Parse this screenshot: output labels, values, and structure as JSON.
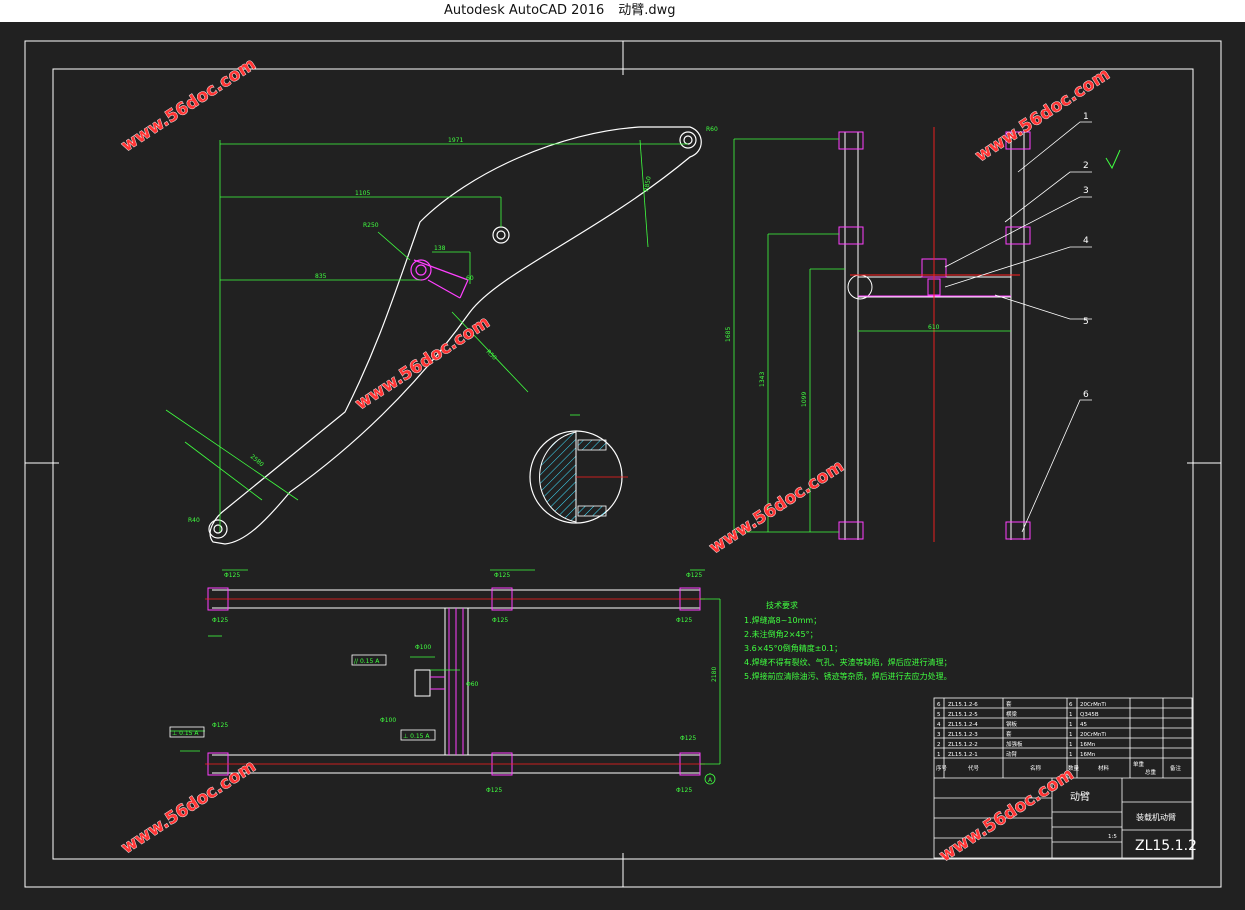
{
  "window": {
    "app_title": "Autodesk AutoCAD 2016",
    "file_name": "动臂.dwg"
  },
  "colors": {
    "background": "#212121",
    "outline": "#ffffff",
    "dimension": "#40ff40",
    "part": "#ff40ff",
    "centerline": "#ff2020",
    "watermark": "#ff3535"
  },
  "watermark": {
    "text": "www.56doc.com"
  },
  "drawing": {
    "drawing_number": "ZL15.1.2",
    "scale": "1:5",
    "balloons": [
      "1",
      "2",
      "3",
      "4",
      "5",
      "6"
    ],
    "dimensions": {
      "side": [
        "1971",
        "1105",
        "835",
        "R250",
        "138",
        "60",
        "R850",
        "R60",
        "R40",
        "R50",
        "2580"
      ],
      "front": [
        "1685",
        "1343",
        "1099",
        "610"
      ],
      "plan": [
        "Φ125",
        "Φ125",
        "Φ125",
        "Φ125",
        "Φ125",
        "Φ125",
        "Φ125",
        "Φ125",
        "Φ100",
        "Φ100",
        "Φ60",
        "2180",
        "Φ125",
        "Φ125"
      ]
    },
    "tolerance_frames": [
      "// 0.15 A",
      "⊥ 0.15 A",
      "⊥ 0.15 A"
    ],
    "datum_label": "A"
  },
  "tech_notes": {
    "title": "技术要求",
    "lines": [
      "1.焊缝高8~10mm；",
      "2.未注倒角2×45°；",
      "3.6×45°0倒角精度±0.1；",
      "4.焊缝不得有裂纹、气孔、夹渣等缺陷，焊后应进行清理；",
      "5.焊接前应清除油污、锈迹等杂质，焊后进行去应力处理。"
    ]
  },
  "title_block": {
    "rows": [
      {
        "no": "6",
        "code": "ZL15.1.2-6",
        "name": "套",
        "qty": "6",
        "material": "20CrMnTi"
      },
      {
        "no": "5",
        "code": "ZL15.1.2-5",
        "name": "横梁",
        "qty": "1",
        "material": "Q345B"
      },
      {
        "no": "4",
        "code": "ZL15.1.2-4",
        "name": "钢板",
        "qty": "1",
        "material": "45"
      },
      {
        "no": "3",
        "code": "ZL15.1.2-3",
        "name": "套",
        "qty": "1",
        "material": "20CrMnTi"
      },
      {
        "no": "2",
        "code": "ZL15.1.2-2",
        "name": "加强板",
        "qty": "1",
        "material": "16Mn"
      },
      {
        "no": "1",
        "code": "ZL15.1.2-1",
        "name": "动臂",
        "qty": "1",
        "material": "16Mn"
      }
    ],
    "header": [
      "序号",
      "代号",
      "名称",
      "数量",
      "材料",
      "单重",
      "总重",
      "备注"
    ],
    "part_name": "动臂",
    "school": "装载机动臂"
  }
}
